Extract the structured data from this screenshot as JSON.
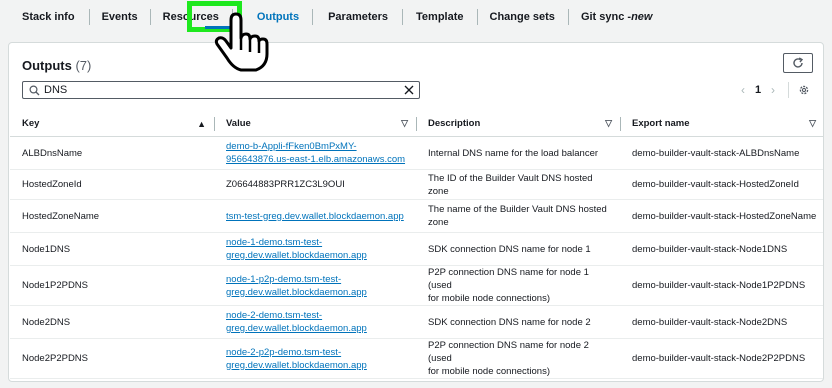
{
  "tabs": [
    {
      "label": "Stack info"
    },
    {
      "label": "Events"
    },
    {
      "label": "Resources"
    },
    {
      "label": "Outputs"
    },
    {
      "label": "Parameters"
    },
    {
      "label": "Template"
    },
    {
      "label": "Change sets"
    },
    {
      "label": "Git sync - ",
      "badge": "new"
    }
  ],
  "panel": {
    "title": "Outputs",
    "count": "(7)"
  },
  "search": {
    "value": "DNS"
  },
  "pagination": {
    "page": "1"
  },
  "table": {
    "headers": [
      "Key",
      "Value",
      "Description",
      "Export name"
    ],
    "rows": [
      {
        "key": "ALBDnsName",
        "value_line1": "demo-b-Appli-fFken0BmPxMY-",
        "value_line2": "956643876.us-east-1.elb.amazonaws.com",
        "value_is_link": true,
        "desc_line1": "Internal DNS name for the load balancer",
        "desc_line2": "",
        "export": "demo-builder-vault-stack-ALBDnsName"
      },
      {
        "key": "HostedZoneId",
        "value_line1": "Z06644883PRR1ZC3L9OUI",
        "value_line2": "",
        "value_is_link": false,
        "desc_line1": "The ID of the Builder Vault DNS hosted zone",
        "desc_line2": "",
        "export": "demo-builder-vault-stack-HostedZoneId"
      },
      {
        "key": "HostedZoneName",
        "value_line1": "tsm-test-greg.dev.wallet.blockdaemon.app",
        "value_line2": "",
        "value_is_link": true,
        "desc_line1": "The name of the Builder Vault DNS hosted",
        "desc_line2": "zone",
        "export": "demo-builder-vault-stack-HostedZoneName"
      },
      {
        "key": "Node1DNS",
        "value_line1": "node-1-demo.tsm-test-",
        "value_line2": "greg.dev.wallet.blockdaemon.app",
        "value_is_link": true,
        "desc_line1": "SDK connection DNS name for node 1",
        "desc_line2": "",
        "export": "demo-builder-vault-stack-Node1DNS"
      },
      {
        "key": "Node1P2PDNS",
        "value_line1": "node-1-p2p-demo.tsm-test-",
        "value_line2": "greg.dev.wallet.blockdaemon.app",
        "value_is_link": true,
        "desc_line1": "P2P connection DNS name for node 1 (used",
        "desc_line2": "for mobile node connections)",
        "export": "demo-builder-vault-stack-Node1P2PDNS"
      },
      {
        "key": "Node2DNS",
        "value_line1": "node-2-demo.tsm-test-",
        "value_line2": "greg.dev.wallet.blockdaemon.app",
        "value_is_link": true,
        "desc_line1": "SDK connection DNS name for node 2",
        "desc_line2": "",
        "export": "demo-builder-vault-stack-Node2DNS"
      },
      {
        "key": "Node2P2PDNS",
        "value_line1": "node-2-p2p-demo.tsm-test-",
        "value_line2": "greg.dev.wallet.blockdaemon.app",
        "value_is_link": true,
        "desc_line1": "P2P connection DNS name for node 2 (used",
        "desc_line2": "for mobile node connections)",
        "export": "demo-builder-vault-stack-Node2P2PDNS"
      }
    ]
  },
  "colors": {
    "link": "#0073bb",
    "highlight": "#1ee81e"
  }
}
